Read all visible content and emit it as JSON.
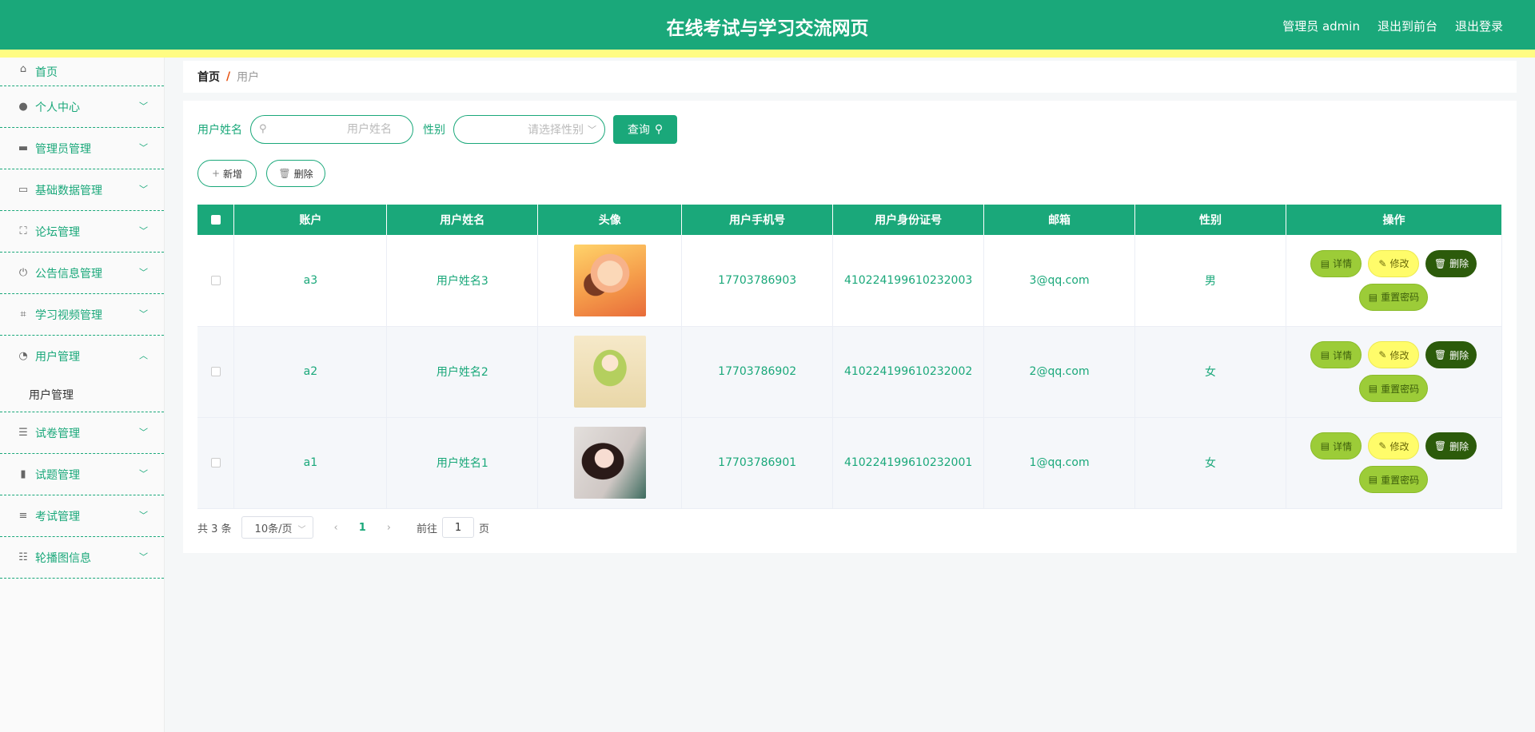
{
  "header": {
    "title": "在线考试与学习交流网页",
    "admin_label": "管理员 admin",
    "to_front_label": "退出到前台",
    "logout_label": "退出登录"
  },
  "sidebar": {
    "items": [
      {
        "label": "首页",
        "icon": "home-icon"
      },
      {
        "label": "个人中心",
        "icon": "user-icon"
      },
      {
        "label": "管理员管理",
        "icon": "monitor-icon"
      },
      {
        "label": "基础数据管理",
        "icon": "briefcase-icon"
      },
      {
        "label": "论坛管理",
        "icon": "fullscreen-icon"
      },
      {
        "label": "公告信息管理",
        "icon": "power-icon"
      },
      {
        "label": "学习视频管理",
        "icon": "crop-icon"
      },
      {
        "label": "用户管理",
        "icon": "gauge-icon",
        "expanded": true,
        "children": [
          {
            "label": "用户管理"
          }
        ]
      },
      {
        "label": "试卷管理",
        "icon": "sliders-icon"
      },
      {
        "label": "试题管理",
        "icon": "bar-chart-icon"
      },
      {
        "label": "考试管理",
        "icon": "menu-icon"
      },
      {
        "label": "轮播图信息",
        "icon": "list-icon"
      }
    ]
  },
  "breadcrumb": {
    "home": "首页",
    "separator": "/",
    "current": "用户"
  },
  "search": {
    "name_label": "用户姓名",
    "name_placeholder": "用户姓名",
    "name_value": "",
    "gender_label": "性别",
    "gender_placeholder": "请选择性别",
    "query_label": "查询"
  },
  "actions": {
    "add_label": "新增",
    "delete_label": "删除"
  },
  "table": {
    "headers": [
      "账户",
      "用户姓名",
      "头像",
      "用户手机号",
      "用户身份证号",
      "邮箱",
      "性别",
      "操作"
    ],
    "rows": [
      {
        "account": "a3",
        "name": "用户姓名3",
        "phone": "17703786903",
        "id_card": "410224199610232003",
        "email": "3@qq.com",
        "gender": "男"
      },
      {
        "account": "a2",
        "name": "用户姓名2",
        "phone": "17703786902",
        "id_card": "410224199610232002",
        "email": "2@qq.com",
        "gender": "女"
      },
      {
        "account": "a1",
        "name": "用户姓名1",
        "phone": "17703786901",
        "id_card": "410224199610232001",
        "email": "1@qq.com",
        "gender": "女"
      }
    ],
    "row_actions": {
      "detail": "详情",
      "edit": "修改",
      "delete": "删除",
      "reset": "重置密码"
    }
  },
  "pagination": {
    "total_text": "共 3 条",
    "page_size": "10条/页",
    "current_page": "1",
    "goto_label": "前往",
    "goto_value": "1",
    "page_suffix": "页"
  },
  "colors": {
    "primary": "#1aa87a",
    "stripe": "#fffc83",
    "detail": "#9ccc38",
    "edit": "#fffc6a",
    "delete": "#2c5b0b"
  }
}
